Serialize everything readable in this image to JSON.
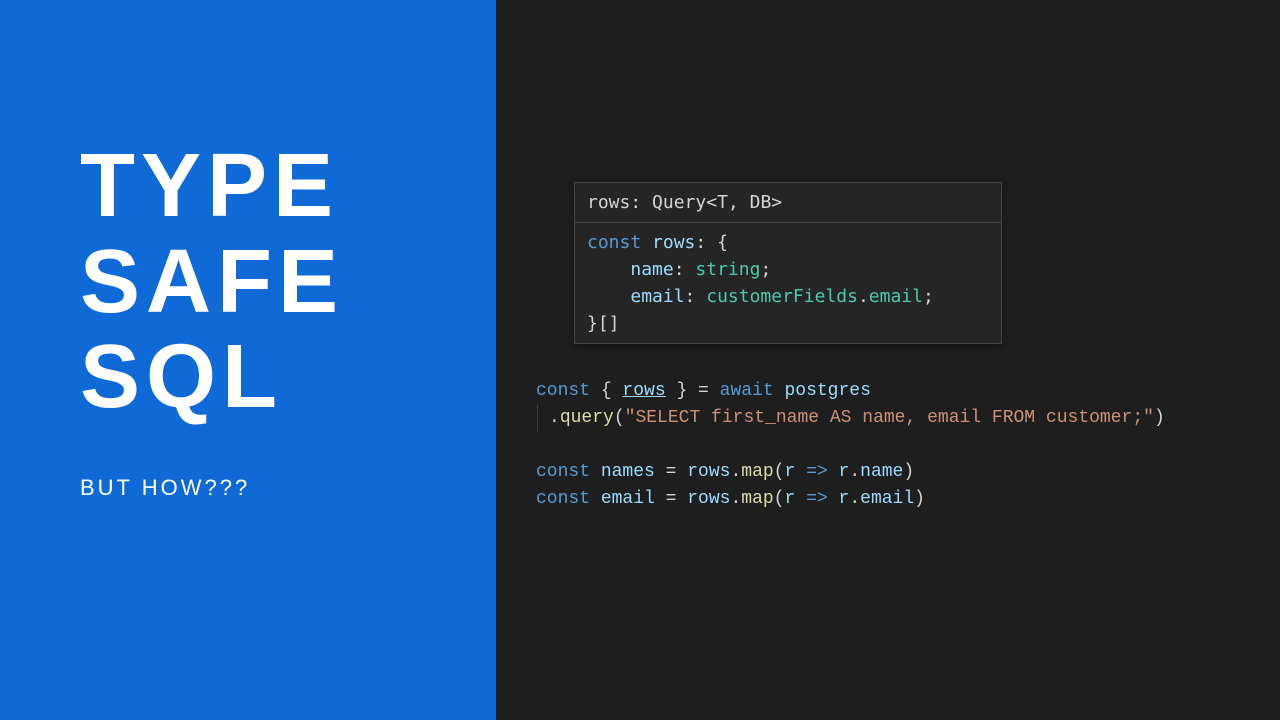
{
  "left": {
    "title_lines": [
      "TYPE",
      "SAFE",
      "SQL"
    ],
    "subtitle": "BUT HOW???"
  },
  "colors": {
    "accent_blue": "#0f6ad8",
    "editor_bg": "#1e1e1e",
    "popup_bg": "#252526",
    "popup_border": "#454545",
    "keyword": "#569cd6",
    "variable": "#9cdcfe",
    "type": "#4ec9b0",
    "function": "#dcdcaa",
    "string": "#ce9178",
    "foreground": "#d4d4d4"
  },
  "hover": {
    "header": {
      "tokens": [
        {
          "t": "rows",
          "c": "plain"
        },
        {
          "t": ": ",
          "c": "plain"
        },
        {
          "t": "Query",
          "c": "plain"
        },
        {
          "t": "<",
          "c": "plain"
        },
        {
          "t": "T",
          "c": "plain"
        },
        {
          "t": ", ",
          "c": "plain"
        },
        {
          "t": "DB",
          "c": "plain"
        },
        {
          "t": ">",
          "c": "plain"
        }
      ]
    },
    "body_lines": [
      [
        {
          "t": "const ",
          "c": "key"
        },
        {
          "t": "rows",
          "c": "var"
        },
        {
          "t": ": {",
          "c": "punc"
        }
      ],
      [
        {
          "t": "    ",
          "c": "plain"
        },
        {
          "t": "name",
          "c": "var"
        },
        {
          "t": ": ",
          "c": "punc"
        },
        {
          "t": "string",
          "c": "type"
        },
        {
          "t": ";",
          "c": "punc"
        }
      ],
      [
        {
          "t": "    ",
          "c": "plain"
        },
        {
          "t": "email",
          "c": "var"
        },
        {
          "t": ": ",
          "c": "punc"
        },
        {
          "t": "customerFields",
          "c": "type"
        },
        {
          "t": ".",
          "c": "punc"
        },
        {
          "t": "email",
          "c": "type"
        },
        {
          "t": ";",
          "c": "punc"
        }
      ],
      [
        {
          "t": "}[]",
          "c": "punc"
        }
      ]
    ]
  },
  "code_lines": [
    [
      {
        "t": "const ",
        "c": "key"
      },
      {
        "t": "{ ",
        "c": "punc"
      },
      {
        "t": "rows",
        "c": "var",
        "underline": true
      },
      {
        "t": " } = ",
        "c": "punc"
      },
      {
        "t": "await ",
        "c": "key"
      },
      {
        "t": "postgres",
        "c": "var"
      }
    ],
    [
      {
        "t": "  .",
        "c": "punc",
        "guide": true
      },
      {
        "t": "query",
        "c": "call"
      },
      {
        "t": "(",
        "c": "punc"
      },
      {
        "t": "\"SELECT first_name AS name, email FROM customer;\"",
        "c": "str"
      },
      {
        "t": ")",
        "c": "punc"
      }
    ],
    [],
    [
      {
        "t": "const ",
        "c": "key"
      },
      {
        "t": "names",
        "c": "var"
      },
      {
        "t": " = ",
        "c": "punc"
      },
      {
        "t": "rows",
        "c": "var"
      },
      {
        "t": ".",
        "c": "punc"
      },
      {
        "t": "map",
        "c": "call"
      },
      {
        "t": "(",
        "c": "punc"
      },
      {
        "t": "r",
        "c": "var"
      },
      {
        "t": " ",
        "c": "punc"
      },
      {
        "t": "=>",
        "c": "arrow"
      },
      {
        "t": " ",
        "c": "punc"
      },
      {
        "t": "r",
        "c": "var"
      },
      {
        "t": ".",
        "c": "punc"
      },
      {
        "t": "name",
        "c": "var"
      },
      {
        "t": ")",
        "c": "punc"
      }
    ],
    [
      {
        "t": "const ",
        "c": "key"
      },
      {
        "t": "email",
        "c": "var"
      },
      {
        "t": " = ",
        "c": "punc"
      },
      {
        "t": "rows",
        "c": "var"
      },
      {
        "t": ".",
        "c": "punc"
      },
      {
        "t": "map",
        "c": "call"
      },
      {
        "t": "(",
        "c": "punc"
      },
      {
        "t": "r",
        "c": "var"
      },
      {
        "t": " ",
        "c": "punc"
      },
      {
        "t": "=>",
        "c": "arrow"
      },
      {
        "t": " ",
        "c": "punc"
      },
      {
        "t": "r",
        "c": "var"
      },
      {
        "t": ".",
        "c": "punc"
      },
      {
        "t": "email",
        "c": "var"
      },
      {
        "t": ")",
        "c": "punc"
      }
    ]
  ]
}
